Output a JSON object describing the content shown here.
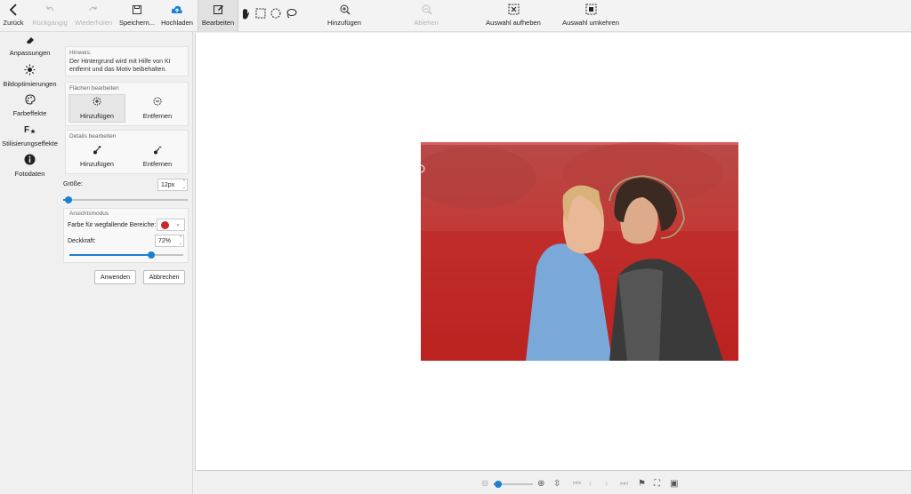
{
  "toolbar": {
    "back": "Zurück",
    "undo": "Rückgängig",
    "redo": "Wiederholen",
    "save": "Speichern...",
    "upload": "Hochladen",
    "edit": "Bearbeiten",
    "add": "Hinzufügen",
    "remove": "Ablehen",
    "deselect": "Auswahl aufheben",
    "invert": "Auswahl umkehren"
  },
  "leftnav": {
    "items": [
      {
        "label": "Anpassungen",
        "icon": "eraser-icon"
      },
      {
        "label": "Bildoptimierungen",
        "icon": "sun-icon"
      },
      {
        "label": "Farbeffekte",
        "icon": "palette-icon"
      },
      {
        "label": "Stilisierungseffekte",
        "icon": "font-star-icon"
      },
      {
        "label": "Fotodaten",
        "icon": "info-icon"
      }
    ]
  },
  "panel": {
    "hint_title": "Hinweis:",
    "hint_text": "Der Hintergrund wird mit Hilfe von KI entfernt und das Motiv beibehalten.",
    "areas_title": "Flächen bearbeiten",
    "areas_add": "Hinzufügen",
    "areas_remove": "Entfernen",
    "details_title": "Details bearbeiten",
    "details_add": "Hinzufügen",
    "details_remove": "Entfernen",
    "size_label": "Größe:",
    "size_value": "12px",
    "size_level": 0.04,
    "view_title": "Ansichtsmodus",
    "color_label": "Farbe für wegfallende Bereiche:",
    "opacity_label": "Deckkraft:",
    "opacity_value": "72%",
    "opacity_level": 0.72,
    "apply": "Anwenden",
    "cancel": "Abbrechen"
  },
  "colors": {
    "overlay": "#c8282a",
    "accent": "#1a7fd4"
  },
  "statusbar": {
    "zoom_level": 0.12
  }
}
